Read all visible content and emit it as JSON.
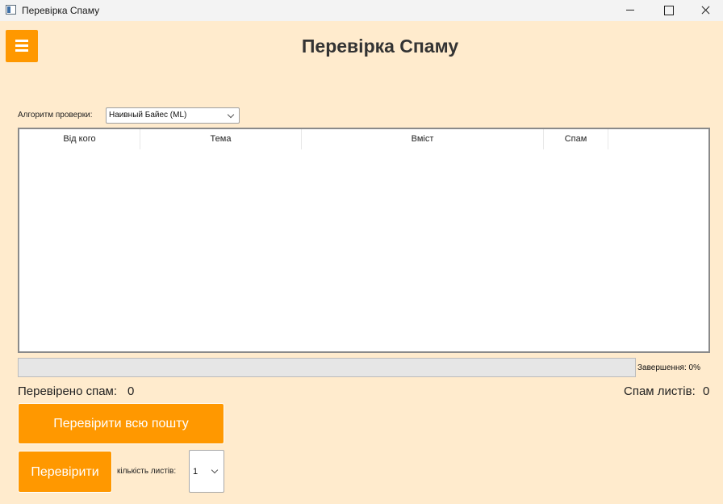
{
  "window": {
    "title": "Перевірка Спаму"
  },
  "header": {
    "title": "Перевірка Спаму"
  },
  "algorithm": {
    "label": "Алгоритм проверки:",
    "selected": "Наивный Байес (ML)"
  },
  "table": {
    "columns": [
      "Від кого",
      "Тема",
      "Вміст",
      "Спам"
    ],
    "rows": []
  },
  "progress": {
    "percent": 0,
    "label": "Завершення: 0%"
  },
  "stats": {
    "checked_label": "Перевірено спам:",
    "checked_value": "0",
    "spam_label": "Спам листів:",
    "spam_value": "0"
  },
  "actions": {
    "check_all_label": "Перевірити всю пошту",
    "check_label": "Перевірити",
    "count_label": "кількість листів:",
    "count_value": "1"
  },
  "colors": {
    "background": "#ffebcd",
    "accent": "#ff9800"
  }
}
